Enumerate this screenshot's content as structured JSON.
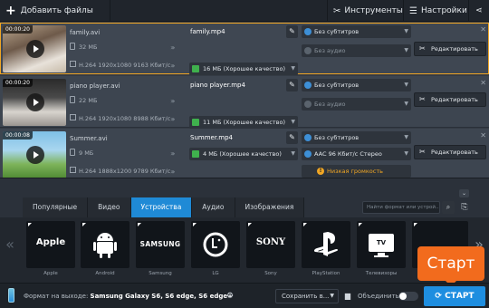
{
  "toolbar": {
    "add_files": "Добавить файлы",
    "tools": "Инструменты",
    "settings": "Настройки"
  },
  "files": [
    {
      "duration": "00:00:20",
      "name": "family.avi",
      "size": "32 МБ",
      "info": "H.264 1920x1080 9163 Кбит/с",
      "output_name": "family.mp4",
      "output_quality": "16 МБ (Хорошее качество)",
      "subtitles": "Без субтитров",
      "audio": "Без аудио",
      "edit": "Редактировать",
      "selected": true
    },
    {
      "duration": "00:00:20",
      "name": "piano player.avi",
      "size": "22 МБ",
      "info": "H.264 1920x1080 8988 Кбит/с",
      "output_name": "piano player.mp4",
      "output_quality": "11 МБ (Хорошее качество)",
      "subtitles": "Без субтитров",
      "audio": "Без аудио",
      "edit": "Редактировать",
      "selected": false
    },
    {
      "duration": "00:00:08",
      "name": "Summer.avi",
      "size": "9 МБ",
      "info": "H.264 1888x1200 9789 Кбит/с",
      "output_name": "Summer.mp4",
      "output_quality": "4 МБ (Хорошее качество)",
      "subtitles": "Без субтитров",
      "audio": "AAC 96 Кбит/с Стерео",
      "edit": "Редактировать",
      "warning": "Низкая громкость",
      "selected": false
    }
  ],
  "tabs": [
    "Популярные",
    "Видео",
    "Устройства",
    "Аудио",
    "Изображения"
  ],
  "active_tab": "Устройства",
  "search_placeholder": "Найти формат или устрой...",
  "devices": [
    {
      "logo": "Apple",
      "label": "Apple"
    },
    {
      "logo": "android-icon",
      "label": "Android"
    },
    {
      "logo": "SAMSUNG",
      "label": "Samsung"
    },
    {
      "logo": "LG",
      "label": "LG"
    },
    {
      "logo": "SONY",
      "label": "Sony"
    },
    {
      "logo": "playstation-icon",
      "label": "PlayStation"
    },
    {
      "logo": "TV",
      "label": "Телевизоры"
    }
  ],
  "bottom": {
    "format_label": "Формат на выходе:",
    "format_value": "Samsung Galaxy S6, S6 edge, S6 edge+",
    "save_to": "Сохранить в...",
    "merge": "Объединить:",
    "start": "СТАРТ"
  },
  "tooltip": {
    "text": "Старт"
  },
  "colors": {
    "accent": "#1e8ee0",
    "selection": "#f0a624",
    "warning": "#f0a624",
    "tooltip": "#f26b1d",
    "quality_ok": "#3fb04d"
  }
}
